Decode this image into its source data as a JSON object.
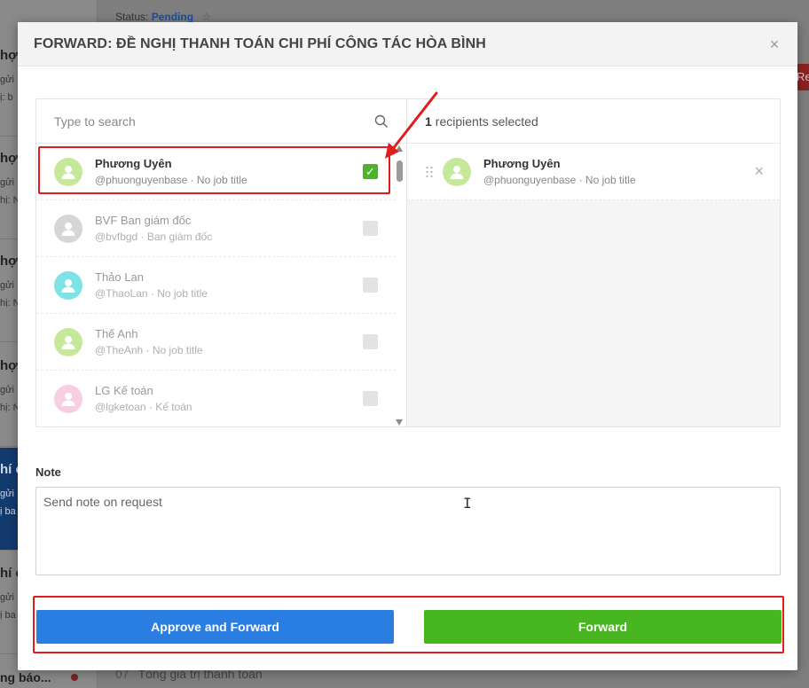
{
  "background": {
    "status_label": "Status:",
    "status_value": "Pending",
    "left_items": [
      {
        "title": "hợ",
        "line1": "gửi",
        "line2": "ị: b"
      },
      {
        "title": "hợ",
        "line1": "gửi",
        "line2": "hị: N"
      },
      {
        "title": "hợ",
        "line1": "gửi",
        "line2": "hị: N"
      },
      {
        "title": "hợ",
        "line1": "gửi",
        "line2": "hị: N"
      },
      {
        "title": "hí c",
        "line1": "gửi",
        "line2": "ị ba"
      },
      {
        "title": "hí c",
        "line1": "gửi",
        "line2": "ị ba"
      }
    ],
    "red_button_label": "Re",
    "bottom_number": "07",
    "bottom_text": "Tổng giá trị thanh toán",
    "last_item_title": "ng báo..."
  },
  "modal": {
    "title": "FORWARD: ĐỀ NGHỊ THANH TOÁN CHI PHÍ CÔNG TÁC HÒA BÌNH",
    "search_placeholder": "Type to search",
    "users": [
      {
        "name": "Phương Uyên",
        "sub": "@phuonguyenbase · No job title",
        "checked": true,
        "avatar_color": "#c6e89a"
      },
      {
        "name": "BVF Ban giám đốc",
        "sub": "@bvfbgd · Ban giám đốc",
        "checked": false,
        "avatar_color": "#d6d6d6"
      },
      {
        "name": "Thảo Lan",
        "sub": "@ThaoLan · No job title",
        "checked": false,
        "avatar_color": "#7fe3e6"
      },
      {
        "name": "Thế Anh",
        "sub": "@TheAnh · No job title",
        "checked": false,
        "avatar_color": "#c6e89a"
      },
      {
        "name": "LG Kế toán",
        "sub": "@lgketoan · Kế toán",
        "checked": false,
        "avatar_color": "#f6cfe0"
      }
    ],
    "selected_count": "1",
    "selected_label": "recipients selected",
    "selected": [
      {
        "name": "Phương Uyên",
        "sub": "@phuonguyenbase · No job title",
        "avatar_color": "#c6e89a"
      }
    ],
    "note_label": "Note",
    "note_placeholder": "Send note on request",
    "approve_button": "Approve and Forward",
    "forward_button": "Forward",
    "colors": {
      "approve": "#2a7de1",
      "forward": "#47b620",
      "highlight": "#e11c1c"
    }
  }
}
